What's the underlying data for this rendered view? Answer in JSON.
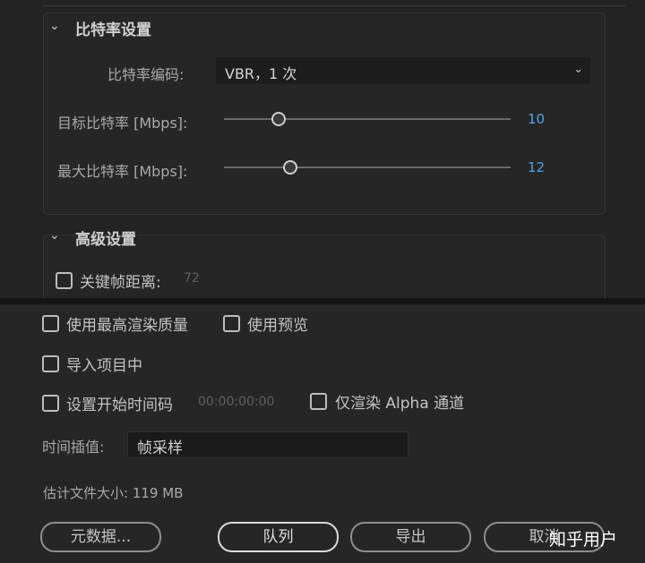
{
  "bitrate": {
    "title": "比特率设置",
    "encoding_label": "比特率编码:",
    "encoding_value": "VBR，1 次",
    "target_label": "目标比特率 [Mbps]:",
    "target_value": "10",
    "target_fraction": 0.19,
    "max_label": "最大比特率 [Mbps]:",
    "max_value": "12",
    "max_fraction": 0.23
  },
  "advanced": {
    "title": "高级设置",
    "keyframe_label": "关键帧距离:",
    "keyframe_value": "72"
  },
  "options": {
    "max_quality": "使用最高渲染质量",
    "use_previews": "使用预览",
    "import_project": "导入项目中",
    "set_timecode": "设置开始时间码",
    "timecode_value": "00:00:00:00",
    "alpha_only": "仅渲染 Alpha 通道",
    "interp_label": "时间插值:",
    "interp_value": "帧采样",
    "filesize": "估计文件大小: 119 MB"
  },
  "buttons": {
    "metadata": "元数据...",
    "queue": "队列",
    "export": "导出",
    "cancel": "取消"
  },
  "watermark": "知乎用户",
  "colors": {
    "accent": "#4aa3e8"
  }
}
